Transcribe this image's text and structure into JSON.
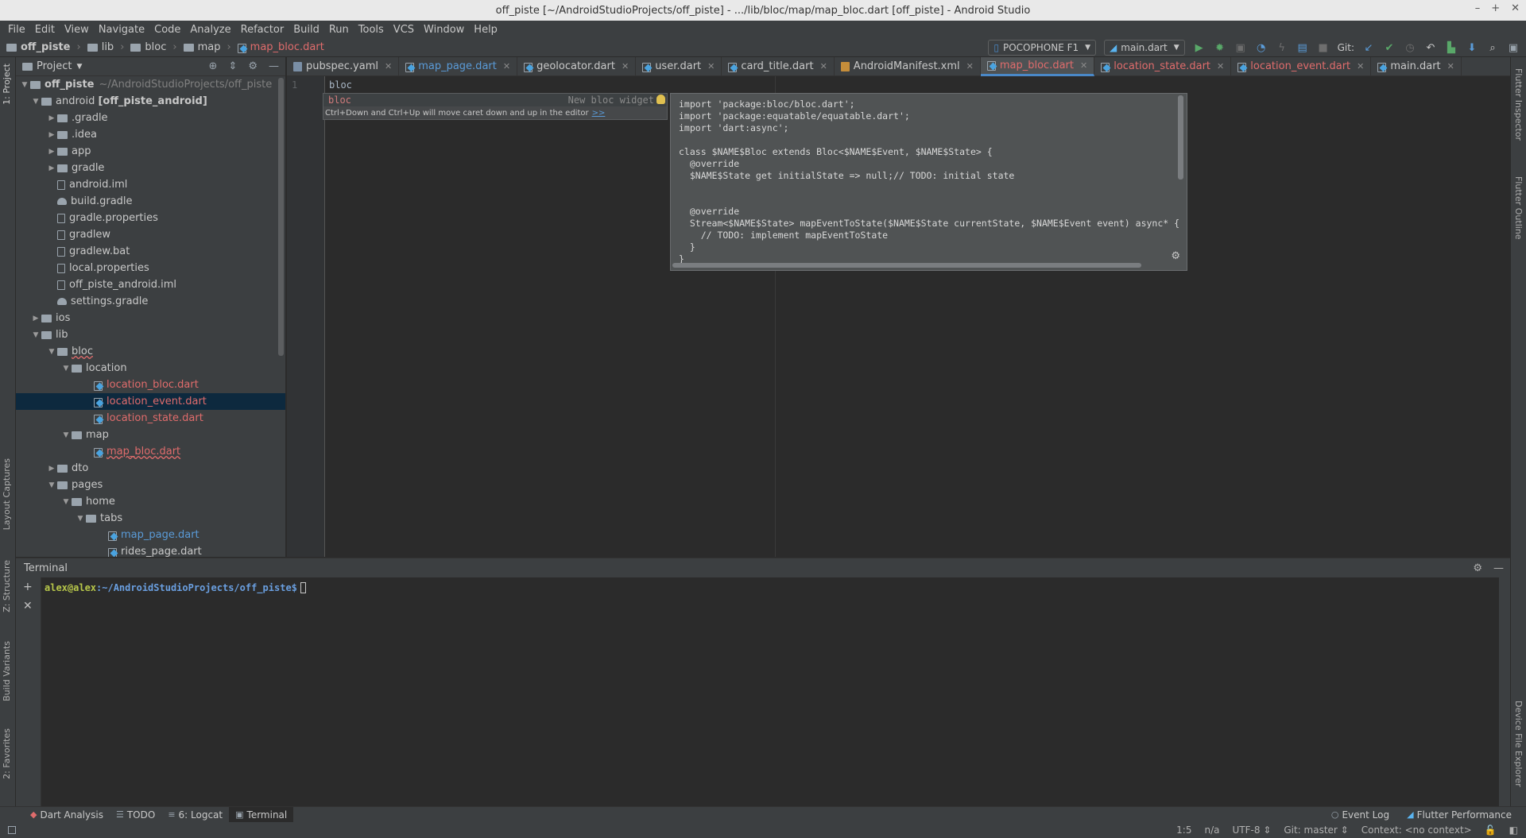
{
  "window": {
    "title": "off_piste [~/AndroidStudioProjects/off_piste] - .../lib/bloc/map/map_bloc.dart [off_piste] - Android Studio",
    "controls": [
      "–",
      "+",
      "✕"
    ]
  },
  "menu": [
    "File",
    "Edit",
    "View",
    "Navigate",
    "Code",
    "Analyze",
    "Refactor",
    "Build",
    "Run",
    "Tools",
    "VCS",
    "Window",
    "Help"
  ],
  "breadcrumb": [
    "off_piste",
    "lib",
    "bloc",
    "map",
    "map_bloc.dart"
  ],
  "toolbar": {
    "device": "POCOPHONE F1",
    "run_config": "main.dart",
    "git_label": "Git:"
  },
  "project_panel": {
    "title": "Project",
    "tree": [
      {
        "label": "off_piste",
        "extra": "~/AndroidStudioProjects/off_piste"
      },
      {
        "label": "android",
        "extra": "[off_piste_android]"
      },
      {
        "label": ".gradle"
      },
      {
        "label": ".idea"
      },
      {
        "label": "app"
      },
      {
        "label": "gradle"
      },
      {
        "label": "android.iml"
      },
      {
        "label": "build.gradle"
      },
      {
        "label": "gradle.properties"
      },
      {
        "label": "gradlew"
      },
      {
        "label": "gradlew.bat"
      },
      {
        "label": "local.properties"
      },
      {
        "label": "off_piste_android.iml"
      },
      {
        "label": "settings.gradle"
      },
      {
        "label": "ios"
      },
      {
        "label": "lib"
      },
      {
        "label": "bloc"
      },
      {
        "label": "location"
      },
      {
        "label": "location_bloc.dart"
      },
      {
        "label": "location_event.dart"
      },
      {
        "label": "location_state.dart"
      },
      {
        "label": "map"
      },
      {
        "label": "map_bloc.dart"
      },
      {
        "label": "dto"
      },
      {
        "label": "pages"
      },
      {
        "label": "home"
      },
      {
        "label": "tabs"
      },
      {
        "label": "map_page.dart"
      },
      {
        "label": "rides_page.dart"
      }
    ]
  },
  "tabs": [
    "pubspec.yaml",
    "map_page.dart",
    "geolocator.dart",
    "user.dart",
    "card_title.dart",
    "AndroidManifest.xml",
    "map_bloc.dart",
    "location_state.dart",
    "location_event.dart",
    "main.dart"
  ],
  "editor": {
    "line_number": "1",
    "code": "bloc",
    "completion": {
      "keyword": "bloc",
      "description": "New bloc widget",
      "hint": "Ctrl+Down and Ctrl+Up will move caret down and up in the editor",
      "hint_link": ">>"
    },
    "template_preview": "import 'package:bloc/bloc.dart';\nimport 'package:equatable/equatable.dart';\nimport 'dart:async';\n\nclass $NAME$Bloc extends Bloc<$NAME$Event, $NAME$State> {\n  @override\n  $NAME$State get initialState => null;// TODO: initial state\n\n\n  @override\n  Stream<$NAME$State> mapEventToState($NAME$State currentState, $NAME$Event event) async* {\n    // TODO: implement mapEventToState\n  }\n}"
  },
  "terminal": {
    "title": "Terminal",
    "user": "alex@alex",
    "path": ":~/AndroidStudioProjects/off_piste$"
  },
  "left_stripe": [
    "1: Project",
    "Layout Captures",
    "Z: Structure",
    "Build Variants",
    "2: Favorites"
  ],
  "right_stripe": [
    "Flutter Inspector",
    "Flutter Outline",
    "Device File Explorer"
  ],
  "bottom_tools": [
    "Dart Analysis",
    "TODO",
    "6: Logcat",
    "Terminal"
  ],
  "bottom_tools_right": [
    "Event Log",
    "Flutter Performance"
  ],
  "status": {
    "position": "1:5",
    "na": "n/a",
    "encoding": "UTF-8 ⇕",
    "git": "Git: master ⇕",
    "context": "Context: <no context>"
  }
}
